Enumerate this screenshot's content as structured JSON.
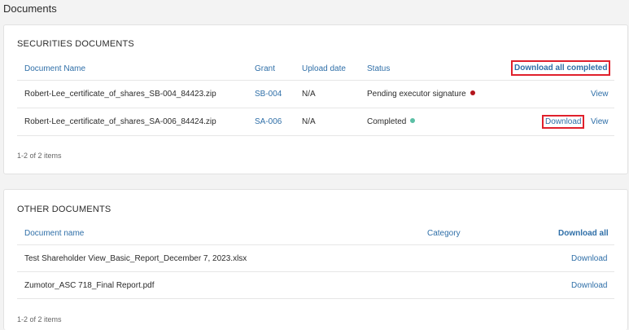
{
  "page": {
    "title": "Documents"
  },
  "securities": {
    "title": "SECURITIES DOCUMENTS",
    "columns": {
      "name": "Document Name",
      "grant": "Grant",
      "upload": "Upload date",
      "status": "Status",
      "download_all": "Download all completed"
    },
    "rows": [
      {
        "name": "Robert-Lee_certificate_of_shares_SB-004_84423.zip",
        "grant": "SB-004",
        "upload": "N/A",
        "status": "Pending executor signature",
        "status_color": "#b3151c",
        "download": "",
        "view": "View"
      },
      {
        "name": "Robert-Lee_certificate_of_shares_SA-006_84424.zip",
        "grant": "SA-006",
        "upload": "N/A",
        "status": "Completed",
        "status_color": "#5bbfa5",
        "download": "Download",
        "view": "View"
      }
    ],
    "count": "1-2 of 2 items"
  },
  "other": {
    "title": "OTHER DOCUMENTS",
    "columns": {
      "name": "Document name",
      "category": "Category",
      "download_all": "Download all"
    },
    "rows": [
      {
        "name": "Test Shareholder View_Basic_Report_December 7, 2023.xlsx",
        "category": "",
        "download": "Download"
      },
      {
        "name": "Zumotor_ASC 718_Final Report.pdf",
        "category": "",
        "download": "Download"
      }
    ],
    "count": "1-2 of 2 items"
  },
  "colors": {
    "link": "#2f6fa8",
    "highlight": "#e0202c"
  }
}
